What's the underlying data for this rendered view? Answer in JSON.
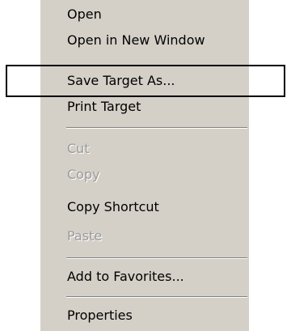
{
  "context_menu": {
    "items": [
      {
        "label": "Open",
        "enabled": true
      },
      {
        "label": "Open in New Window",
        "enabled": true
      },
      {
        "label": "Save Target As...",
        "enabled": true
      },
      {
        "label": "Print Target",
        "enabled": true
      },
      {
        "label": "Cut",
        "enabled": false
      },
      {
        "label": "Copy",
        "enabled": false
      },
      {
        "label": "Copy Shortcut",
        "enabled": true
      },
      {
        "label": "Paste",
        "enabled": false
      },
      {
        "label": "Add to Favorites...",
        "enabled": true
      },
      {
        "label": "Properties",
        "enabled": true
      }
    ],
    "highlighted_item": "Save Target As...",
    "colors": {
      "menu_background": "#d4d0c8",
      "disabled_text": "#9a9a9a",
      "separator_dark": "#808080",
      "separator_light": "#ffffff",
      "highlight_box": "#000000"
    }
  }
}
